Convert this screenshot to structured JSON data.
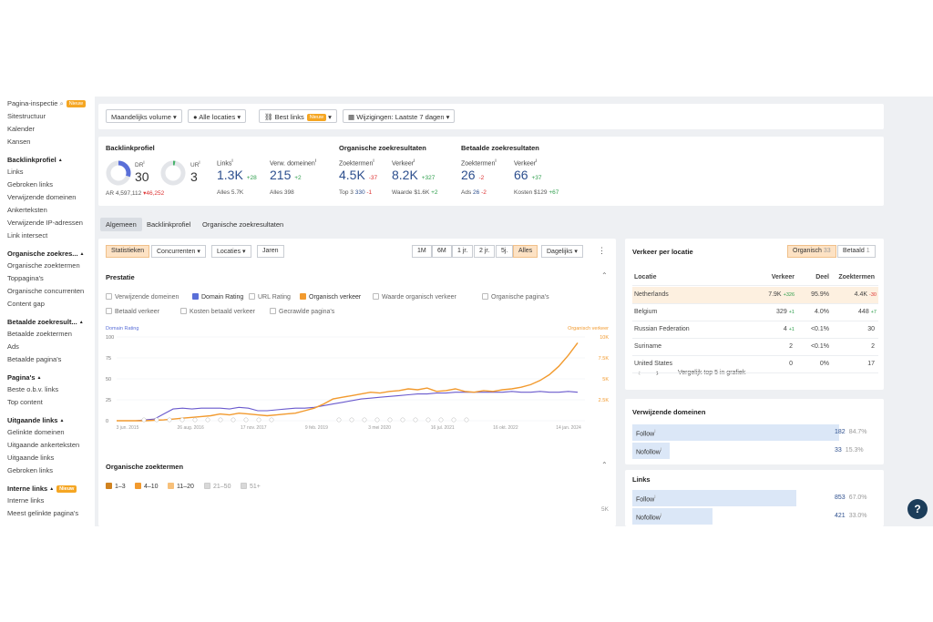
{
  "sidebar": {
    "items": [
      {
        "label": "Pagina-inspectie",
        "badge": "Nieuw",
        "kind": "item",
        "icon": "search-icon"
      },
      {
        "label": "Sitestructuur",
        "kind": "item"
      },
      {
        "label": "Kalender",
        "kind": "item"
      },
      {
        "label": "Kansen",
        "kind": "item"
      },
      {
        "label": "Backlinkprofiel",
        "kind": "head"
      },
      {
        "label": "Links",
        "kind": "item"
      },
      {
        "label": "Gebroken links",
        "kind": "item"
      },
      {
        "label": "Verwijzende domeinen",
        "kind": "item"
      },
      {
        "label": "Ankerteksten",
        "kind": "item"
      },
      {
        "label": "Verwijzende IP-adressen",
        "kind": "item"
      },
      {
        "label": "Link intersect",
        "kind": "item"
      },
      {
        "label": "Organische zoekres...",
        "kind": "head"
      },
      {
        "label": "Organische zoektermen",
        "kind": "item"
      },
      {
        "label": "Toppagina's",
        "kind": "item"
      },
      {
        "label": "Organische concurrenten",
        "kind": "item"
      },
      {
        "label": "Content gap",
        "kind": "item"
      },
      {
        "label": "Betaalde zoekresult...",
        "kind": "head"
      },
      {
        "label": "Betaalde zoektermen",
        "kind": "item"
      },
      {
        "label": "Ads",
        "kind": "item"
      },
      {
        "label": "Betaalde pagina's",
        "kind": "item"
      },
      {
        "label": "Pagina's",
        "kind": "head"
      },
      {
        "label": "Beste o.b.v. links",
        "kind": "item"
      },
      {
        "label": "Top content",
        "kind": "item"
      },
      {
        "label": "Uitgaande links",
        "kind": "head"
      },
      {
        "label": "Gelinkte domeinen",
        "kind": "item"
      },
      {
        "label": "Uitgaande ankerteksten",
        "kind": "item"
      },
      {
        "label": "Uitgaande links",
        "kind": "item"
      },
      {
        "label": "Gebroken links",
        "kind": "item"
      },
      {
        "label": "Interne links",
        "badge": "Nieuw",
        "kind": "head"
      },
      {
        "label": "Interne links",
        "kind": "item"
      },
      {
        "label": "Meest gelinkte pagina's",
        "kind": "item"
      }
    ]
  },
  "filters": {
    "volume": "Maandelijks volume",
    "locations": "Alle locaties",
    "links": "Best links",
    "links_badge": "Nieuw",
    "changes": "Wijzigingen: Laatste 7 dagen"
  },
  "metrics": {
    "backlink_title": "Backlinkprofiel",
    "dr_label": "DR",
    "dr_value": "30",
    "dr_fraction": 0.3,
    "ur_label": "UR",
    "ur_value": "3",
    "ur_fraction": 0.03,
    "ar_label": "AR",
    "ar_value": "4,597,112",
    "ar_delta": "▾46,252",
    "links_label": "Links",
    "links_value": "1.3K",
    "links_delta": "+28",
    "links_sub": "Alles 5.7K",
    "domains_label": "Verw. domeinen",
    "domains_value": "215",
    "domains_delta": "+2",
    "domains_sub": "Alles 398",
    "organic_title": "Organische zoekresultaten",
    "org_kw_label": "Zoektermen",
    "org_kw_value": "4.5K",
    "org_kw_delta": "-37",
    "org_kw_sub": "Top 3",
    "org_kw_sub_value": "330",
    "org_kw_sub_delta": "-1",
    "org_traffic_label": "Verkeer",
    "org_traffic_value": "8.2K",
    "org_traffic_delta": "+327",
    "org_traffic_sub": "Waarde $1.6K",
    "org_traffic_sub_delta": "+2",
    "paid_title": "Betaalde zoekresultaten",
    "paid_kw_label": "Zoektermen",
    "paid_kw_value": "26",
    "paid_kw_delta": "-2",
    "paid_kw_sub": "Ads",
    "paid_kw_sub_value": "26",
    "paid_kw_sub_delta": "-2",
    "paid_traffic_label": "Verkeer",
    "paid_traffic_value": "66",
    "paid_traffic_delta": "+37",
    "paid_traffic_sub": "Kosten $129",
    "paid_traffic_sub_delta": "+67"
  },
  "tabs": [
    "Algemeen",
    "Backlinkprofiel",
    "Organische zoekresultaten"
  ],
  "chart_controls": {
    "left": [
      "Statistieken",
      "Concurrenten",
      "Locaties",
      "Jaren"
    ],
    "ranges": [
      "1M",
      "6M",
      "1 jr.",
      "2 jr.",
      "5j.",
      "Alles"
    ],
    "interval": "Dagelijks"
  },
  "performance": {
    "title": "Prestatie",
    "checkboxes_row1": [
      {
        "label": "Verwijzende domeinen",
        "checked": false
      },
      {
        "label": "Domain Rating",
        "checked": true,
        "color": "#5a6fd8"
      },
      {
        "label": "URL Rating",
        "checked": false
      },
      {
        "label": "Organisch verkeer",
        "checked": true,
        "color": "#f29a2e"
      },
      {
        "label": "Waarde organisch verkeer",
        "checked": false
      },
      {
        "label": "Organische pagina's",
        "checked": false
      }
    ],
    "checkboxes_row2": [
      {
        "label": "Betaald verkeer",
        "checked": false
      },
      {
        "label": "Kosten betaald verkeer",
        "checked": false
      },
      {
        "label": "Gecrawlde pagina's",
        "checked": false
      }
    ]
  },
  "chart_data": {
    "type": "line",
    "left_axis_label": "Domain Rating",
    "right_axis_label": "Organisch verkeer",
    "left_ticks": [
      "100",
      "75",
      "50",
      "25",
      "0"
    ],
    "right_ticks": [
      "10K",
      "7.5K",
      "5K",
      "2.5K",
      ""
    ],
    "x_ticks": [
      "3 jun. 2015",
      "26 aug. 2016",
      "17 nov. 2017",
      "9 feb. 2019",
      "3 mei 2020",
      "16 jul. 2021",
      "16 okt. 2022",
      "14 jan. 2024"
    ],
    "ylim_left": [
      0,
      100
    ],
    "ylim_right": [
      0,
      10000
    ],
    "series": [
      {
        "name": "Domain Rating",
        "color": "#6a5acd",
        "values": [
          0,
          0,
          0,
          1,
          2,
          8,
          14,
          15,
          14,
          15,
          15,
          15,
          14,
          16,
          15,
          12,
          12,
          13,
          14,
          15,
          15,
          16,
          18,
          20,
          22,
          24,
          26,
          27,
          28,
          29,
          30,
          31,
          32,
          32,
          33,
          33,
          34,
          34,
          34,
          34,
          34,
          34,
          35,
          34,
          34,
          35,
          34,
          34,
          35,
          34
        ]
      },
      {
        "name": "Organisch verkeer",
        "color": "#f29a2e",
        "values": [
          0,
          0,
          0,
          0,
          50,
          100,
          200,
          300,
          400,
          500,
          600,
          800,
          700,
          900,
          800,
          700,
          600,
          700,
          800,
          900,
          1200,
          1500,
          2000,
          2600,
          2800,
          3000,
          3200,
          3400,
          3300,
          3500,
          3600,
          3800,
          3700,
          3900,
          3500,
          3600,
          3800,
          3500,
          3400,
          3600,
          3500,
          3700,
          3800,
          4000,
          4300,
          4800,
          5500,
          6500,
          7800,
          9300
        ]
      }
    ]
  },
  "keywords": {
    "title": "Organische zoektermen",
    "buckets": [
      "1–3",
      "4–10",
      "11–20",
      "21–50",
      "51+"
    ],
    "axis_tick": "5K"
  },
  "traffic_by_location": {
    "title": "Verkeer per locatie",
    "toggle_organic": "Organisch",
    "toggle_organic_count": "33",
    "toggle_paid": "Betaald",
    "toggle_paid_count": "1",
    "columns": [
      "Locatie",
      "Verkeer",
      "Deel",
      "Zoektermen"
    ],
    "rows": [
      {
        "location": "Netherlands",
        "traffic": "7.9K",
        "traffic_delta": "+326",
        "share": "95.9%",
        "keywords": "4.4K",
        "keywords_delta": "-30"
      },
      {
        "location": "Belgium",
        "traffic": "329",
        "traffic_delta": "+1",
        "share": "4.0%",
        "keywords": "448",
        "keywords_delta": "+7"
      },
      {
        "location": "Russian Federation",
        "traffic": "4",
        "traffic_delta": "+1",
        "share": "<0.1%",
        "keywords": "30",
        "keywords_delta": ""
      },
      {
        "location": "Suriname",
        "traffic": "2",
        "traffic_delta": "",
        "share": "<0.1%",
        "keywords": "2",
        "keywords_delta": ""
      },
      {
        "location": "United States",
        "traffic": "0",
        "traffic_delta": "",
        "share": "0%",
        "keywords": "17",
        "keywords_delta": ""
      }
    ],
    "compare_label": "Vergelijk top 5 in grafiek"
  },
  "referring_domains": {
    "title": "Verwijzende domeinen",
    "rows": [
      {
        "label": "Follow",
        "value": "182",
        "pct": "84.7%",
        "fraction": 0.847
      },
      {
        "label": "Nofollow",
        "value": "33",
        "pct": "15.3%",
        "fraction": 0.153
      }
    ]
  },
  "links_panel": {
    "title": "Links",
    "rows": [
      {
        "label": "Follow",
        "value": "853",
        "pct": "67.0%",
        "fraction": 0.67
      },
      {
        "label": "Nofollow",
        "value": "421",
        "pct": "33.0%",
        "fraction": 0.33
      }
    ]
  },
  "help_label": "?"
}
